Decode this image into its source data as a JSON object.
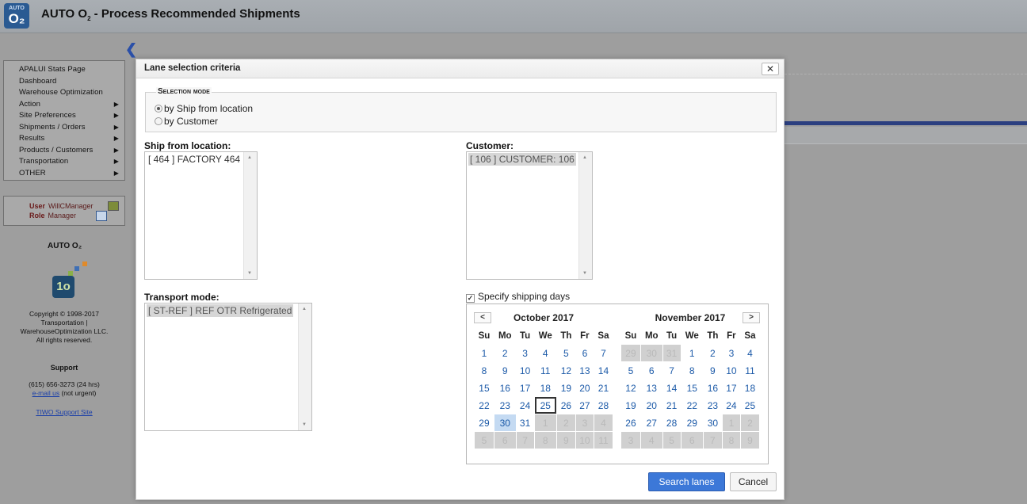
{
  "app": {
    "logo_top": "AUTO",
    "logo_main": "O₂",
    "title_prefix": "AUTO O",
    "title_sub": "2",
    "title_suffix": " - Process Recommended Shipments"
  },
  "leftnav": {
    "items": [
      {
        "label": "APALUI Stats Page",
        "has_submenu": false
      },
      {
        "label": "Dashboard",
        "has_submenu": false
      },
      {
        "label": "Warehouse Optimization",
        "has_submenu": false
      },
      {
        "label": "Action",
        "has_submenu": true
      },
      {
        "label": "Site Preferences",
        "has_submenu": true
      },
      {
        "label": "Shipments / Orders",
        "has_submenu": true
      },
      {
        "label": "Results",
        "has_submenu": true
      },
      {
        "label": "Products / Customers",
        "has_submenu": true
      },
      {
        "label": "Transportation",
        "has_submenu": true
      },
      {
        "label": "OTHER",
        "has_submenu": true
      }
    ],
    "submenu_arrow": "▶"
  },
  "userbox": {
    "user_label": "User",
    "user_value": "WillCManager",
    "role_label": "Role",
    "role_value": "Manager"
  },
  "sidebar": {
    "product_name": "AUTO O₂",
    "logo_text": "1o",
    "copyright_lines": [
      "Copyright © 1998-2017",
      "Transportation |",
      "WarehouseOptimization LLC.",
      "All rights reserved."
    ],
    "support_heading": "Support",
    "phone": "(615) 656-3273 (24 hrs)",
    "email_link": "e-mail us",
    "email_note": " (not urgent)",
    "support_site_link": "TIWO Support Site"
  },
  "dialog": {
    "title": "Lane selection criteria",
    "close_label": "✕",
    "selection_mode": {
      "legend": "Selection mode",
      "options": [
        {
          "label": "by Ship from location",
          "selected": true
        },
        {
          "label": "by Customer",
          "selected": false
        }
      ]
    },
    "ship_from": {
      "label": "Ship from location:",
      "items": [
        "[ 464 ] FACTORY 464"
      ]
    },
    "customer": {
      "label": "Customer:",
      "items": [
        "[ 106 ] CUSTOMER: 106"
      ]
    },
    "transport_mode": {
      "label": "Transport mode:",
      "items": [
        "[ ST-REF ] REF OTR Refrigerated"
      ]
    },
    "shipping_days": {
      "label": "Specify shipping days",
      "checked": true,
      "check_mark": "✓"
    },
    "calendar": {
      "weekdays": [
        "Su",
        "Mo",
        "Tu",
        "We",
        "Th",
        "Fr",
        "Sa"
      ],
      "prev_label": "<",
      "next_label": ">",
      "months": [
        {
          "title": "October 2017",
          "weeks": [
            [
              [
                "1",
                ""
              ],
              [
                "2",
                ""
              ],
              [
                "3",
                ""
              ],
              [
                "4",
                ""
              ],
              [
                "5",
                ""
              ],
              [
                "6",
                ""
              ],
              [
                "7",
                ""
              ]
            ],
            [
              [
                "8",
                ""
              ],
              [
                "9",
                ""
              ],
              [
                "10",
                ""
              ],
              [
                "11",
                ""
              ],
              [
                "12",
                ""
              ],
              [
                "13",
                ""
              ],
              [
                "14",
                ""
              ]
            ],
            [
              [
                "15",
                ""
              ],
              [
                "16",
                ""
              ],
              [
                "17",
                ""
              ],
              [
                "18",
                ""
              ],
              [
                "19",
                ""
              ],
              [
                "20",
                ""
              ],
              [
                "21",
                ""
              ]
            ],
            [
              [
                "22",
                ""
              ],
              [
                "23",
                ""
              ],
              [
                "24",
                ""
              ],
              [
                "25",
                "today"
              ],
              [
                "26",
                ""
              ],
              [
                "27",
                ""
              ],
              [
                "28",
                ""
              ]
            ],
            [
              [
                "29",
                ""
              ],
              [
                "30",
                "selday"
              ],
              [
                "31",
                ""
              ],
              [
                "1",
                "other"
              ],
              [
                "2",
                "other"
              ],
              [
                "3",
                "other"
              ],
              [
                "4",
                "other"
              ]
            ],
            [
              [
                "5",
                "other"
              ],
              [
                "6",
                "other"
              ],
              [
                "7",
                "other"
              ],
              [
                "8",
                "other"
              ],
              [
                "9",
                "other"
              ],
              [
                "10",
                "other"
              ],
              [
                "11",
                "other"
              ]
            ]
          ]
        },
        {
          "title": "November 2017",
          "weeks": [
            [
              [
                "29",
                "other"
              ],
              [
                "30",
                "other"
              ],
              [
                "31",
                "other"
              ],
              [
                "1",
                ""
              ],
              [
                "2",
                ""
              ],
              [
                "3",
                ""
              ],
              [
                "4",
                ""
              ]
            ],
            [
              [
                "5",
                ""
              ],
              [
                "6",
                ""
              ],
              [
                "7",
                ""
              ],
              [
                "8",
                ""
              ],
              [
                "9",
                ""
              ],
              [
                "10",
                ""
              ],
              [
                "11",
                ""
              ]
            ],
            [
              [
                "12",
                ""
              ],
              [
                "13",
                ""
              ],
              [
                "14",
                ""
              ],
              [
                "15",
                ""
              ],
              [
                "16",
                ""
              ],
              [
                "17",
                ""
              ],
              [
                "18",
                ""
              ]
            ],
            [
              [
                "19",
                ""
              ],
              [
                "20",
                ""
              ],
              [
                "21",
                ""
              ],
              [
                "22",
                ""
              ],
              [
                "23",
                ""
              ],
              [
                "24",
                ""
              ],
              [
                "25",
                ""
              ]
            ],
            [
              [
                "26",
                ""
              ],
              [
                "27",
                ""
              ],
              [
                "28",
                ""
              ],
              [
                "29",
                ""
              ],
              [
                "30",
                ""
              ],
              [
                "1",
                "other"
              ],
              [
                "2",
                "other"
              ]
            ],
            [
              [
                "3",
                "other"
              ],
              [
                "4",
                "other"
              ],
              [
                "5",
                "other"
              ],
              [
                "6",
                "other"
              ],
              [
                "7",
                "other"
              ],
              [
                "8",
                "other"
              ],
              [
                "9",
                "other"
              ]
            ]
          ]
        }
      ]
    },
    "buttons": {
      "search": "Search lanes",
      "cancel": "Cancel"
    }
  },
  "colors": {
    "accent": "#3c78d8",
    "date_link": "#1c5aa8",
    "brand_strip": "#2b3f80"
  }
}
